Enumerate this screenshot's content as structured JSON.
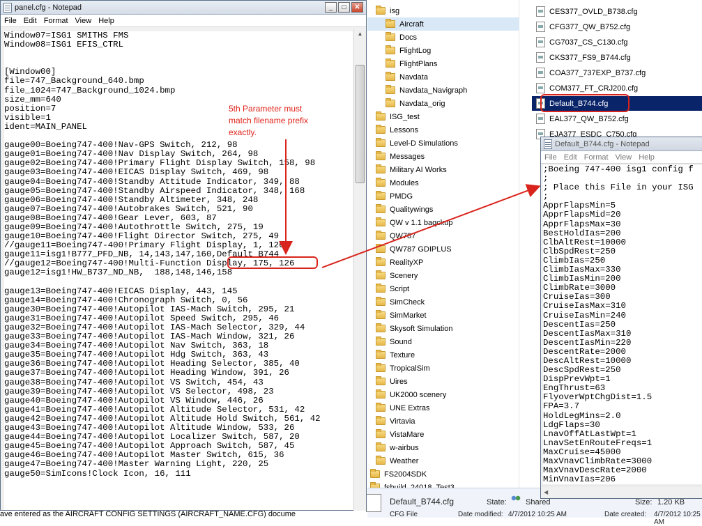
{
  "panel_window": {
    "title": "panel.cfg - Notepad",
    "menu": [
      "File",
      "Edit",
      "Format",
      "View",
      "Help"
    ],
    "lines": [
      "Window07=ISG1 SMITHS FMS",
      "Window08=ISG1 EFIS_CTRL",
      "",
      "",
      "[Window00]",
      "file=747_Background_640.bmp",
      "file_1024=747_Background_1024.bmp",
      "size_mm=640",
      "position=7",
      "visible=1",
      "ident=MAIN_PANEL",
      "",
      "gauge00=Boeing747-400!Nav-GPS Switch, 212, 98",
      "gauge01=Boeing747-400!Nav Display Switch, 264, 98",
      "gauge02=Boeing747-400!Primary Flight Display Switch, 158, 98",
      "gauge03=Boeing747-400!EICAS Display Switch, 469, 98",
      "gauge04=Boeing747-400!Standby Attitude Indicator, 349, 88",
      "gauge05=Boeing747-400!Standby Airspeed Indicator, 348, 168",
      "gauge06=Boeing747-400!Standby Altimeter, 348, 248",
      "gauge07=Boeing747-400!Autobrakes Switch, 521, 90",
      "gauge08=Boeing747-400!Gear Lever, 603, 87",
      "gauge09=Boeing747-400!Autothrottle Switch, 275, 19",
      "gauge10=Boeing747-400!Flight Director Switch, 275, 49",
      "//gauge11=Boeing747-400!Primary Flight Display, 1, 126",
      "gauge11=isg1!B777_PFD_NB, 14,143,147,160,Default_B744",
      "//gauge12=Boeing747-400!Multi-Function Display, 175, 126",
      "gauge12=isg1!HW_B737_ND_NB,  188,148,146,158",
      "",
      "gauge13=Boeing747-400!EICAS Display, 443, 145",
      "gauge14=Boeing747-400!Chronograph Switch, 0, 56",
      "gauge30=Boeing747-400!Autopilot IAS-Mach Switch, 295, 21",
      "gauge31=Boeing747-400!Autopilot Speed Switch, 295, 46",
      "gauge32=Boeing747-400!Autopilot IAS-Mach Selector, 329, 44",
      "gauge33=Boeing747-400!Autopilot IAS-Mach Window, 321, 26",
      "gauge34=Boeing747-400!Autopilot Nav Switch, 363, 18",
      "gauge35=Boeing747-400!Autopilot Hdg Switch, 363, 43",
      "gauge36=Boeing747-400!Autopilot Heading Selector, 385, 40",
      "gauge37=Boeing747-400!Autopilot Heading Window, 391, 26",
      "gauge38=Boeing747-400!Autopilot VS Switch, 454, 43",
      "gauge39=Boeing747-400!Autopilot VS Selector, 498, 23",
      "gauge40=Boeing747-400!Autopilot VS Window, 446, 26",
      "gauge41=Boeing747-400!Autopilot Altitude Selector, 531, 42",
      "gauge42=Boeing747-400!Autopilot Altitude Hold Switch, 561, 42",
      "gauge43=Boeing747-400!Autopilot Altitude Window, 533, 26",
      "gauge44=Boeing747-400!Autopilot Localizer Switch, 587, 20",
      "gauge45=Boeing747-400!Autopilot Approach Switch, 587, 45",
      "gauge46=Boeing747-400!Autopilot Master Switch, 615, 36",
      "gauge47=Boeing747-400!Master Warning Light, 220, 25",
      "gauge50=SimIcons!Clock Icon, 16, 111"
    ]
  },
  "annotation": {
    "text_lines": [
      "5th Parameter must",
      "match filename prefix",
      "exactly."
    ]
  },
  "explorer": {
    "folders": [
      {
        "label": "isg",
        "selected": false
      },
      {
        "label": "Aircraft",
        "selected": true
      },
      {
        "label": "Docs",
        "selected": false
      },
      {
        "label": "FlightLog",
        "selected": false
      },
      {
        "label": "FlightPlans",
        "selected": false
      },
      {
        "label": "Navdata",
        "selected": false
      },
      {
        "label": "Navdata_Navigraph",
        "selected": false
      },
      {
        "label": "Navdata_orig",
        "selected": false
      },
      {
        "label": "ISG_test",
        "selected": false
      },
      {
        "label": "Lessons",
        "selected": false
      },
      {
        "label": "Level-D Simulations",
        "selected": false
      },
      {
        "label": "Messages",
        "selected": false
      },
      {
        "label": "Military AI Works",
        "selected": false
      },
      {
        "label": "Modules",
        "selected": false
      },
      {
        "label": "PMDG",
        "selected": false
      },
      {
        "label": "Qualitywings",
        "selected": false
      },
      {
        "label": "QW v 1.1 baqckup",
        "selected": false
      },
      {
        "label": "QW787",
        "selected": false
      },
      {
        "label": "QW787 GDIPLUS",
        "selected": false
      },
      {
        "label": "RealityXP",
        "selected": false
      },
      {
        "label": "Scenery",
        "selected": false
      },
      {
        "label": "Script",
        "selected": false
      },
      {
        "label": "SimCheck",
        "selected": false
      },
      {
        "label": "SimMarket",
        "selected": false
      },
      {
        "label": "Skysoft Simulation",
        "selected": false
      },
      {
        "label": "Sound",
        "selected": false
      },
      {
        "label": "Texture",
        "selected": false
      },
      {
        "label": "TropicalSim",
        "selected": false
      },
      {
        "label": "Uires",
        "selected": false
      },
      {
        "label": "UK2000 scenery",
        "selected": false
      },
      {
        "label": "UNE Extras",
        "selected": false
      },
      {
        "label": "Virtavia",
        "selected": false
      },
      {
        "label": "VistaMare",
        "selected": false
      },
      {
        "label": "w-airbus",
        "selected": false
      },
      {
        "label": "Weather",
        "selected": false
      },
      {
        "label": "FS2004SDK",
        "selected": false
      },
      {
        "label": "fsbuild_24018_Test3",
        "selected": false
      }
    ],
    "files": [
      {
        "label": "CES377_OVLD_B738.cfg",
        "selected": false
      },
      {
        "label": "CFG377_QW_B752.cfg",
        "selected": false
      },
      {
        "label": "CG7037_CS_C130.cfg",
        "selected": false
      },
      {
        "label": "CKS377_FS9_B744.cfg",
        "selected": false
      },
      {
        "label": "COA377_737EXP_B737.cfg",
        "selected": false
      },
      {
        "label": "COM377_FT_CRJ200.cfg",
        "selected": false
      },
      {
        "label": "Default_B744.cfg",
        "selected": true
      },
      {
        "label": "EAL377_QW_B752.cfg",
        "selected": false
      },
      {
        "label": "EJA377_ESDC_C750.cfg",
        "selected": false
      }
    ],
    "details": {
      "filename": "Default_B744.cfg",
      "type": "CFG File",
      "state_label": "State:",
      "state_value": "Shared",
      "modified_label": "Date modified:",
      "modified_value": "4/7/2012 10:25 AM",
      "size_label": "Size:",
      "size_value": "1.20 KB",
      "created_label": "Date created:",
      "created_value": "4/7/2012 10:25 AM"
    }
  },
  "default_window": {
    "title": "Default_B744.cfg - Notepad",
    "menu": [
      "File",
      "Edit",
      "Format",
      "View",
      "Help"
    ],
    "lines": [
      ";Boeing 747-400 isg1 config f",
      ";",
      "; Place this File in your ISG",
      ";",
      "ApprFlapsMin=5",
      "ApprFlapsMid=20",
      "ApprFlapsMax=30",
      "BestHoldIas=200",
      "ClbAltRest=10000",
      "ClbSpdRest=250",
      "ClimbIas=250",
      "ClimbIasMax=330",
      "ClimbIasMin=200",
      "ClimbRate=3000",
      "CruiseIas=300",
      "CruiseIasMax=310",
      "CruiseIasMin=240",
      "DescentIas=250",
      "DescentIasMax=310",
      "DescentIasMin=220",
      "DescentRate=2000",
      "DescAltRest=10000",
      "DescSpdRest=250",
      "DispPrevWpt=1",
      "EngThrust=63",
      "FlyoverWptChgDist=1.5",
      "FPA=3.7",
      "HoldLegMins=2.0",
      "LdgFlaps=30",
      "LnavOffAtLastWpt=1",
      "LnavSetEnRouteFreqs=1",
      "MaxCruise=45000",
      "MaxVnavClimbRate=3000",
      "MaxVnavDescRate=2000",
      "MinVnavIas=206"
    ]
  },
  "bottom_text": "ave entered as the AIRCRAFT CONFIG SETTINGS (AIRCRAFT_NAME.CFG) docume"
}
